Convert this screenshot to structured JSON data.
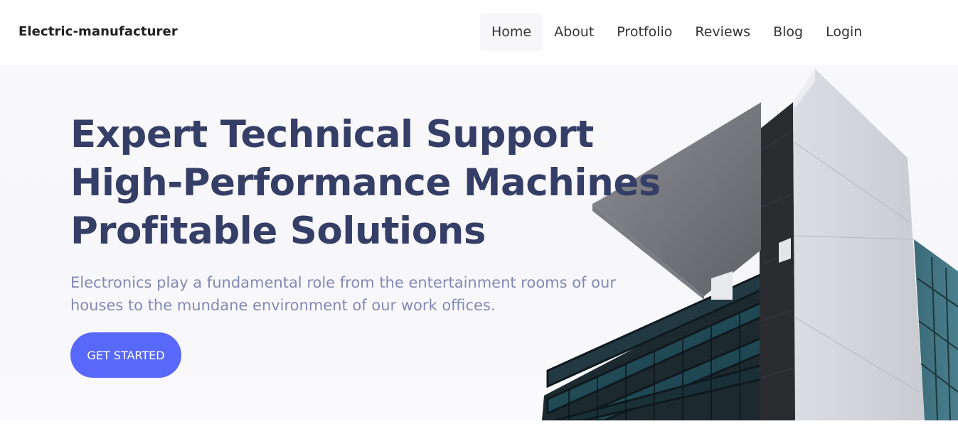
{
  "header": {
    "brand": "Electric-manufacturer",
    "nav": [
      {
        "label": "Home",
        "active": true
      },
      {
        "label": "About"
      },
      {
        "label": "Protfolio"
      },
      {
        "label": "Reviews"
      },
      {
        "label": "Blog"
      },
      {
        "label": "Login"
      }
    ]
  },
  "hero": {
    "title_lines": [
      "Expert Technical Support",
      "High-Performance Machines",
      "Profitable Solutions"
    ],
    "subtitle_lines": [
      "Electronics play a fundamental role from the entertainment rooms of our",
      "houses to the mundane environment of our work offices."
    ],
    "cta_label": "GET STARTED",
    "image": "modern-building-photo"
  },
  "colors": {
    "title": "#353e66",
    "subtitle": "#8289b4",
    "accent": "#5868fa"
  }
}
